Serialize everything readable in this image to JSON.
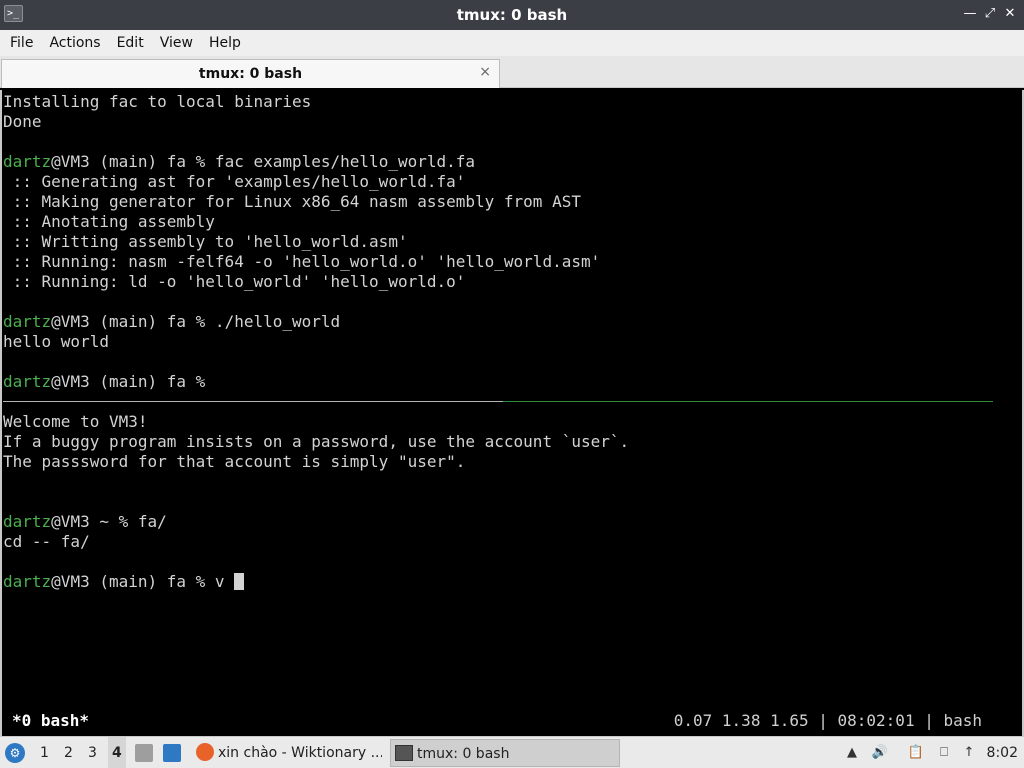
{
  "window": {
    "title": "tmux: 0 bash",
    "app_icon_glyph": ">_"
  },
  "menu": {
    "items": [
      "File",
      "Actions",
      "Edit",
      "View",
      "Help"
    ]
  },
  "tabs": [
    {
      "label": "tmux: 0 bash",
      "close_glyph": "×"
    }
  ],
  "terminal": {
    "colors": {
      "user": "#4caf50",
      "text": "#d3d3d3",
      "background": "#000000"
    },
    "top_pane": [
      {
        "text": "Installing fac to local binaries"
      },
      {
        "text": "Done"
      },
      {
        "text": ""
      },
      {
        "user": "dartz",
        "text": "@VM3 (main) fa % fac examples/hello_world.fa"
      },
      {
        "text": " :: Generating ast for 'examples/hello_world.fa'"
      },
      {
        "text": " :: Making generator for Linux x86_64 nasm assembly from AST"
      },
      {
        "text": " :: Anotating assembly"
      },
      {
        "text": " :: Writting assembly to 'hello_world.asm'"
      },
      {
        "text": " :: Running: nasm -felf64 -o 'hello_world.o' 'hello_world.asm'"
      },
      {
        "text": " :: Running: ld -o 'hello_world' 'hello_world.o'"
      },
      {
        "text": ""
      },
      {
        "user": "dartz",
        "text": "@VM3 (main) fa % ./hello_world"
      },
      {
        "text": "hello world"
      },
      {
        "text": ""
      },
      {
        "user": "dartz",
        "text": "@VM3 (main) fa %"
      }
    ],
    "bottom_pane": [
      {
        "text": "Welcome to VM3!"
      },
      {
        "text": "If a buggy program insists on a password, use the account `user`."
      },
      {
        "text": "The passsword for that account is simply \"user\"."
      },
      {
        "text": ""
      },
      {
        "text": ""
      },
      {
        "user": "dartz",
        "text": "@VM3 ~ % fa/"
      },
      {
        "text": "cd -- fa/"
      },
      {
        "text": ""
      },
      {
        "user": "dartz",
        "text": "@VM3 (main) fa % v "
      }
    ],
    "status": {
      "left": "*0 bash*",
      "right": "0.07 1.38 1.65 | 08:02:01 | bash"
    }
  },
  "taskbar": {
    "workspaces": [
      "1",
      "2",
      "3",
      "4"
    ],
    "active_workspace": "4",
    "tasks": [
      {
        "label": "xin chào - Wiktionary ...",
        "icon": "firefox-icon"
      },
      {
        "label": "tmux: 0 bash",
        "icon": "terminal-icon"
      }
    ],
    "clock": "8:02"
  }
}
